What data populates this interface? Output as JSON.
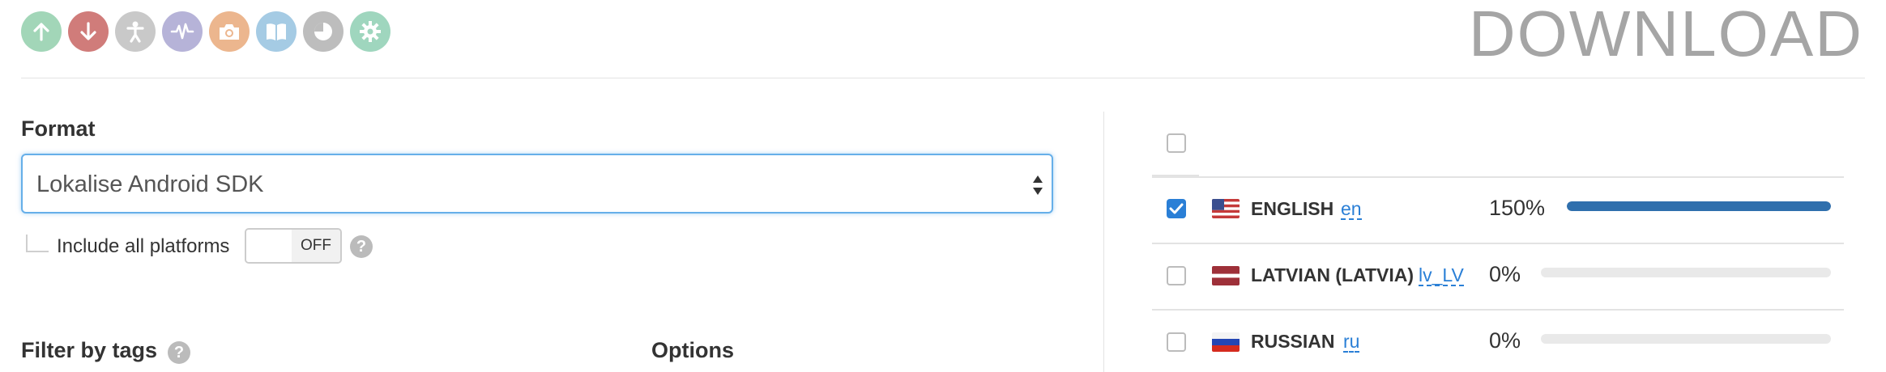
{
  "toolbar": {
    "icons": [
      {
        "name": "upload-icon",
        "color": "#a2d6b8"
      },
      {
        "name": "download-icon",
        "color": "#d07c7a"
      },
      {
        "name": "contributors-icon",
        "color": "#c9c9c9"
      },
      {
        "name": "activity-icon",
        "color": "#b6b3d8"
      },
      {
        "name": "screenshots-icon",
        "color": "#ecb68e"
      },
      {
        "name": "glossary-icon",
        "color": "#a5cbe4"
      },
      {
        "name": "statistics-icon",
        "color": "#bdbdbd"
      },
      {
        "name": "settings-icon",
        "color": "#9fd6be"
      }
    ]
  },
  "page_title": "DOWNLOAD",
  "format": {
    "label": "Format",
    "selected": "Lokalise Android SDK"
  },
  "include_platforms": {
    "label": "Include all platforms",
    "toggle_state": "OFF"
  },
  "filter_by_tags": {
    "label": "Filter by tags"
  },
  "options": {
    "label": "Options"
  },
  "help_glyph": "?",
  "accent_color": "#2a7fd6",
  "languages": [
    {
      "name": "ENGLISH",
      "code": "en",
      "percent_label": "150%",
      "progress": 1.0,
      "checked": true,
      "flag": "us"
    },
    {
      "name": "LATVIAN (LATVIA)",
      "code": "lv_LV",
      "percent_label": "0%",
      "progress": 0.0,
      "checked": false,
      "flag": "lv"
    },
    {
      "name": "RUSSIAN",
      "code": "ru",
      "percent_label": "0%",
      "progress": 0.0,
      "checked": false,
      "flag": "ru"
    }
  ]
}
